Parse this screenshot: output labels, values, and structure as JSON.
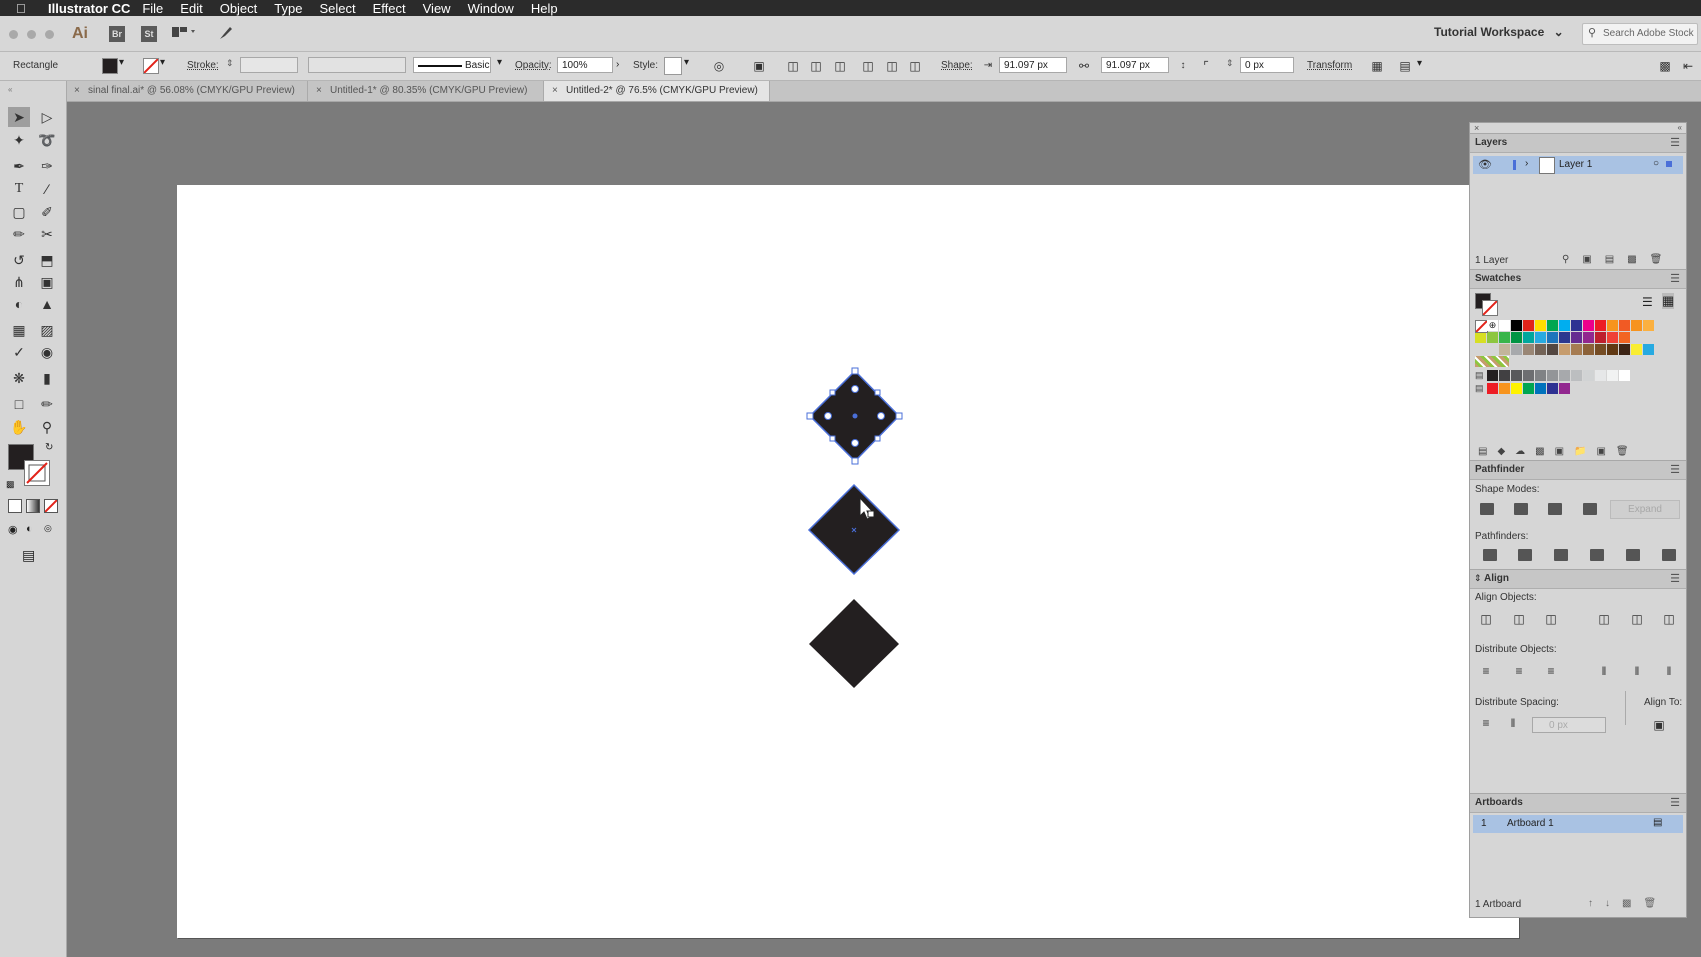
{
  "menubar": {
    "app_name": "Illustrator CC",
    "items": [
      "File",
      "Edit",
      "Object",
      "Type",
      "Select",
      "Effect",
      "View",
      "Window",
      "Help"
    ]
  },
  "appbar": {
    "logo": "Ai",
    "bridge": "Br",
    "stock": "St",
    "workspace": "Tutorial Workspace",
    "search_placeholder": "Search Adobe Stock"
  },
  "controlbar": {
    "object_type": "Rectangle",
    "stroke_label": "Stroke:",
    "brush_label": "Basic",
    "opacity_label": "Opacity:",
    "opacity_value": "100%",
    "style_label": "Style:",
    "shape_label": "Shape:",
    "width_value": "91.097 px",
    "height_value": "91.097 px",
    "corner_value": "0 px",
    "transform_label": "Transform"
  },
  "tabs": [
    {
      "label": "sinal final.ai* @ 56.08% (CMYK/GPU Preview)",
      "active": false
    },
    {
      "label": "Untitled-1* @ 80.35% (CMYK/GPU Preview)",
      "active": false
    },
    {
      "label": "Untitled-2* @ 76.5% (CMYK/GPU Preview)",
      "active": true
    }
  ],
  "layers": {
    "title": "Layers",
    "layer_name": "Layer 1",
    "count": "1 Layer"
  },
  "swatches": {
    "title": "Swatches",
    "row1": [
      "#ffffff",
      "#000000",
      "#e2231a",
      "#ffde00",
      "#00a651",
      "#00aeef",
      "#2e3192",
      "#ec008c",
      "#ed1c24",
      "#f7941d",
      "#f15a24",
      "#f7931e",
      "#fbb040"
    ],
    "row2": [
      "#d7df23",
      "#8dc63f",
      "#39b54a",
      "#009444",
      "#00a79d",
      "#27aae1",
      "#1c75bc",
      "#2b388f",
      "#662d91",
      "#92278f",
      "#be1e2d",
      "#ef4136",
      "#f26522"
    ],
    "row3": [
      "#c2b59b",
      "#a7a9ac",
      "#998675",
      "#736357",
      "#534741",
      "#c69c6d",
      "#a67c52",
      "#8c6239",
      "#754c24",
      "#603813",
      "#3c2415",
      "#f9ed32",
      "#27aae1"
    ],
    "row5": [
      "#231f20",
      "#414042",
      "#58595b",
      "#6d6e71",
      "#808285",
      "#939598",
      "#a7a9ac",
      "#bcbec0",
      "#d1d3d4",
      "#e6e7e8",
      "#f1f2f2",
      "#ffffff"
    ],
    "row6": [
      "#ed1c24",
      "#f7941d",
      "#fff200",
      "#00a651",
      "#0072bc",
      "#2e3192",
      "#92278f"
    ]
  },
  "pathfinder": {
    "title": "Pathfinder",
    "shape_modes": "Shape Modes:",
    "pathfinders": "Pathfinders:",
    "expand": "Expand"
  },
  "align": {
    "title": "Align",
    "align_objects": "Align Objects:",
    "distribute_objects": "Distribute Objects:",
    "distribute_spacing": "Distribute Spacing:",
    "align_to": "Align To:",
    "spacing_value": "0 px"
  },
  "artboards": {
    "title": "Artboards",
    "number": "1",
    "name": "Artboard 1",
    "count": "1 Artboard"
  },
  "colors": {
    "fill": "#231f20",
    "selection": "#4a6fd8",
    "artboard": "#ffffff",
    "pasteboard": "#7b7b7b"
  }
}
